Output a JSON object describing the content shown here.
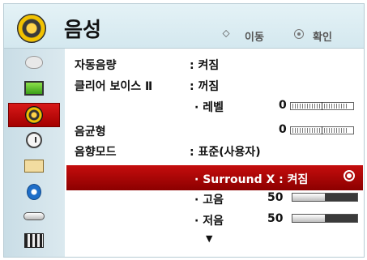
{
  "header": {
    "title": "음성",
    "hint_move": "이동",
    "hint_ok": "확인"
  },
  "sidebar": {
    "items": [
      {
        "icon": "satellite-icon",
        "active": false
      },
      {
        "icon": "picture-icon",
        "active": false
      },
      {
        "icon": "audio-icon",
        "active": true
      },
      {
        "icon": "clock-icon",
        "active": false
      },
      {
        "icon": "options-icon",
        "active": false
      },
      {
        "icon": "lock-icon",
        "active": false
      },
      {
        "icon": "input-icon",
        "active": false
      },
      {
        "icon": "movie-icon",
        "active": false
      }
    ]
  },
  "menu": {
    "auto_volume": {
      "label": "자동음량",
      "value": ": 켜짐"
    },
    "clear_voice": {
      "label": "클리어 보이스 Ⅱ",
      "value": ": 꺼짐"
    },
    "level": {
      "label": "· 레벨",
      "value": "0"
    },
    "balance": {
      "label": "음균형",
      "value": "0"
    },
    "sound_mode": {
      "label": "음향모드",
      "value": ": 표준(사용자)"
    },
    "surround": {
      "label": "· Surround X : 켜짐"
    },
    "treble": {
      "label": "· 고음",
      "value": "50",
      "level": 0.5
    },
    "bass": {
      "label": "· 저음",
      "value": "50",
      "level": 0.5
    },
    "more_arrow": "▼"
  },
  "colors": {
    "highlight": "#b30808",
    "header_bg": "#dbecf2",
    "sidebar_bg": "#d2e3ea"
  }
}
